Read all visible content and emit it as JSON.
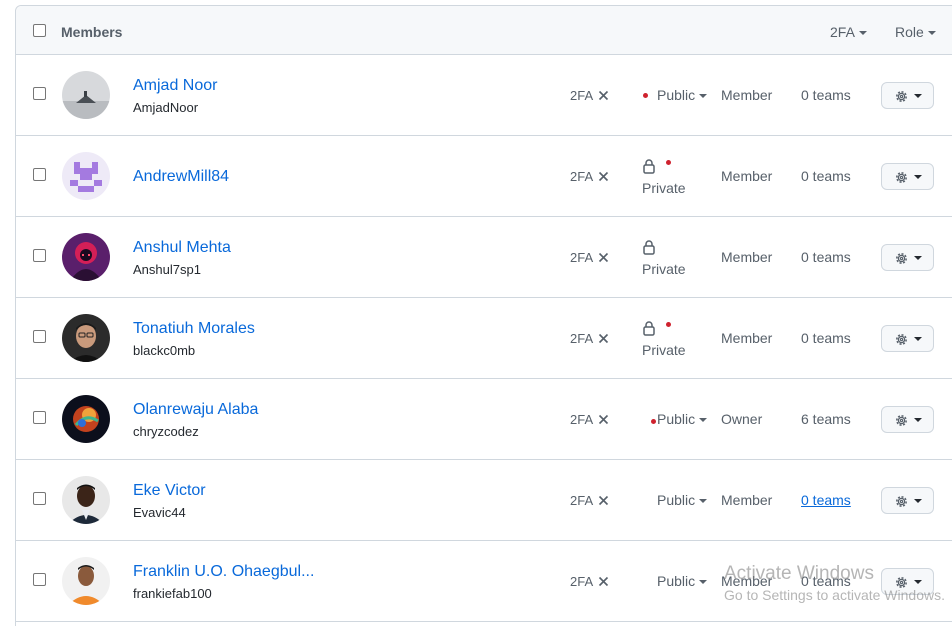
{
  "header": {
    "title": "Members",
    "filter_2fa": "2FA",
    "filter_role": "Role"
  },
  "members": [
    {
      "name": "Amjad Noor",
      "login": "AmjadNoor",
      "twofa": "2FA",
      "visibility": "Public",
      "role": "Member",
      "teams": "0 teams"
    },
    {
      "name": "AndrewMill84",
      "login": "",
      "twofa": "2FA",
      "visibility": "Private",
      "role": "Member",
      "teams": "0 teams"
    },
    {
      "name": "Anshul Mehta",
      "login": "Anshul7sp1",
      "twofa": "2FA",
      "visibility": "Private",
      "role": "Member",
      "teams": "0 teams"
    },
    {
      "name": "Tonatiuh Morales",
      "login": "blackc0mb",
      "twofa": "2FA",
      "visibility": "Private",
      "role": "Member",
      "teams": "0 teams"
    },
    {
      "name": "Olanrewaju Alaba",
      "login": "chryzcodez",
      "twofa": "2FA",
      "visibility": "Public",
      "role": "Owner",
      "teams": "6 teams"
    },
    {
      "name": "Eke Victor",
      "login": "Evavic44",
      "twofa": "2FA",
      "visibility": "Public",
      "role": "Member",
      "teams": "0 teams"
    },
    {
      "name": "Franklin U.O. Ohaegbul...",
      "login": "frankiefab100",
      "twofa": "2FA",
      "visibility": "Public",
      "role": "Member",
      "teams": "0 teams"
    }
  ],
  "watermark": {
    "line1": "Activate Windows",
    "line2": "Go to Settings to activate Windows."
  },
  "colors": {
    "link": "#0969da",
    "alert_dot": "#cf222e",
    "border": "#d0d7de"
  }
}
